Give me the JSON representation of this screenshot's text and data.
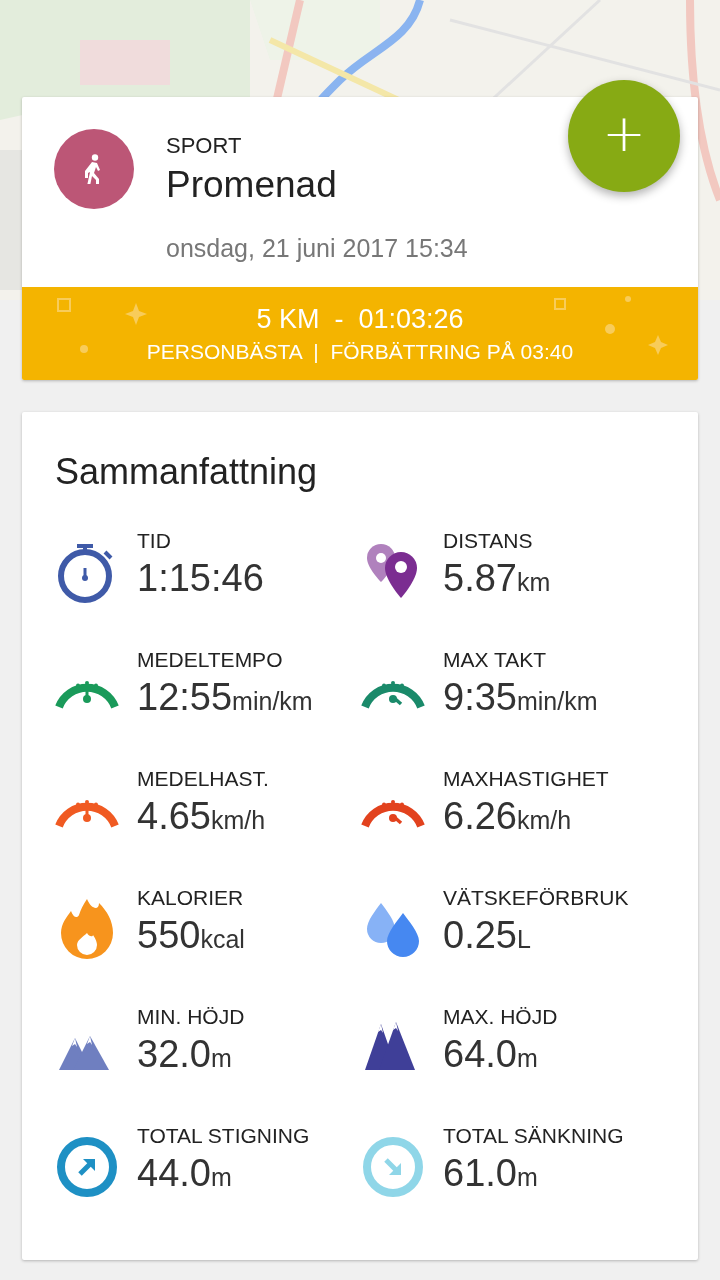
{
  "activity": {
    "category": "SPORT",
    "name": "Promenad",
    "date": "onsdag, 21 juni 2017 15:34"
  },
  "add_button": {
    "label": "+"
  },
  "record": {
    "title": "5 KM  -  01:03:26",
    "subtitle": "PERSONBÄSTA  |  FÖRBÄTTRING PÅ 03:40"
  },
  "summary": {
    "title": "Sammanfattning",
    "stats": [
      {
        "kind": "stopwatch",
        "color": "#3f5aa8",
        "label": "TID",
        "value": "1:15:46"
      },
      {
        "kind": "pins",
        "color": "#7b2d91",
        "label": "DISTANS",
        "value": "5.87",
        "unit": "km"
      },
      {
        "kind": "gauge-avg",
        "color": "#1a9a5a",
        "label": "MEDELTEMPO",
        "value": "12:55",
        "unit": "min/km"
      },
      {
        "kind": "gauge-max",
        "color": "#1a8a6a",
        "label": "MAX TAKT",
        "value": "9:35",
        "unit": "min/km"
      },
      {
        "kind": "gauge-avg",
        "color": "#f05a22",
        "label": "MEDELHAST.",
        "value": "4.65",
        "unit": "km/h"
      },
      {
        "kind": "gauge-max",
        "color": "#e2421e",
        "label": "MAXHASTIGHET",
        "value": "6.26",
        "unit": "km/h"
      },
      {
        "kind": "flame",
        "color": "#f7941d",
        "label": "KALORIER",
        "value": "550",
        "unit": "kcal"
      },
      {
        "kind": "drops",
        "color": "#4688f1",
        "label": "VÄTSKEFÖRBRUK",
        "value": "0.25",
        "unit": "L"
      },
      {
        "kind": "mountains-low",
        "color": "#6f7fc0",
        "label": "MIN. HÖJD",
        "value": "32.0",
        "unit": "m"
      },
      {
        "kind": "mountains-high",
        "color": "#3f3f98",
        "label": "MAX. HÖJD",
        "value": "64.0",
        "unit": "m"
      },
      {
        "kind": "arrow-up",
        "color": "#1e90c4",
        "label": "TOTAL STIGNING",
        "value": "44.0",
        "unit": "m"
      },
      {
        "kind": "arrow-down",
        "color": "#8fd6e8",
        "label": "TOTAL SÄNKNING",
        "value": "61.0",
        "unit": "m"
      }
    ]
  }
}
